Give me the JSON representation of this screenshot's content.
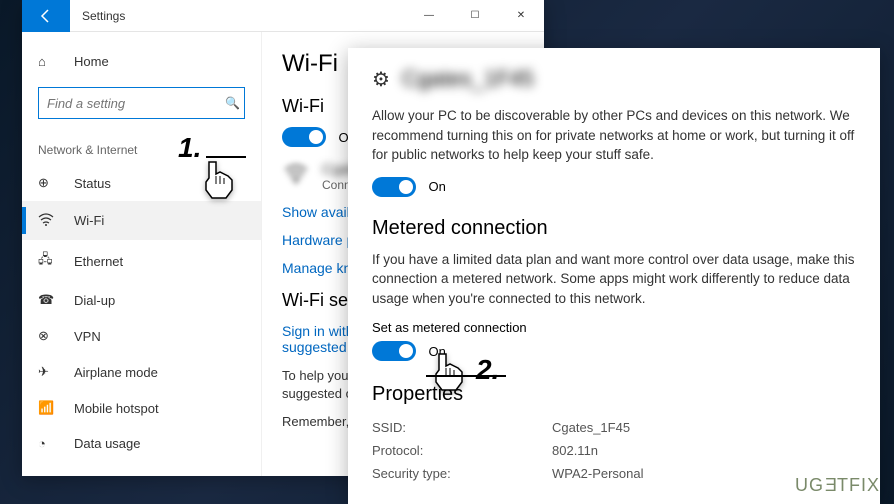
{
  "window": {
    "title": "Settings",
    "controls": {
      "minimize": "—",
      "maximize": "☐",
      "close": "✕"
    }
  },
  "sidebar": {
    "home": "Home",
    "search_placeholder": "Find a setting",
    "category": "Network & Internet",
    "items": [
      {
        "label": "Status",
        "icon": "⊕"
      },
      {
        "label": "Wi-Fi",
        "icon": "⚞"
      },
      {
        "label": "Ethernet",
        "icon": "🖧"
      },
      {
        "label": "Dial-up",
        "icon": "☎"
      },
      {
        "label": "VPN",
        "icon": "⊗"
      },
      {
        "label": "Airplane mode",
        "icon": "✈"
      },
      {
        "label": "Mobile hotspot",
        "icon": "📶"
      },
      {
        "label": "Data usage",
        "icon": "◔"
      }
    ]
  },
  "main": {
    "title": "Wi-Fi",
    "wifi_section": "Wi-Fi",
    "wifi_toggle": "On",
    "network_name": "Cgates_1F45",
    "network_status": "Connected, secu",
    "links": {
      "show": "Show available networ",
      "hardware": "Hardware properties",
      "manage": "Manage known netwo"
    },
    "services_title": "Wi-Fi services",
    "signin": "Sign in with your Micro\nsuggested open hotsp",
    "help_text": "To help you stay conne\nsuggested open Wi-Fi",
    "remember": "Remember, not all Wi-"
  },
  "detail": {
    "network_name": "Cgates_1F45",
    "discover_text": "Allow your PC to be discoverable by other PCs and devices on this network. We recommend turning this on for private networks at home or work, but turning it off for public networks to help keep your stuff safe.",
    "discover_toggle": "On",
    "metered_title": "Metered connection",
    "metered_text": "If you have a limited data plan and want more control over data usage, make this connection a metered network. Some apps might work differently to reduce data usage when you're connected to this network.",
    "metered_label": "Set as metered connection",
    "metered_toggle": "On",
    "props_title": "Properties",
    "props": [
      {
        "key": "SSID:",
        "value": "Cgates_1F45"
      },
      {
        "key": "Protocol:",
        "value": "802.11n"
      },
      {
        "key": "Security type:",
        "value": "WPA2-Personal"
      }
    ]
  },
  "callouts": {
    "one": "1.",
    "two": "2."
  },
  "watermark": "UGETFIX"
}
